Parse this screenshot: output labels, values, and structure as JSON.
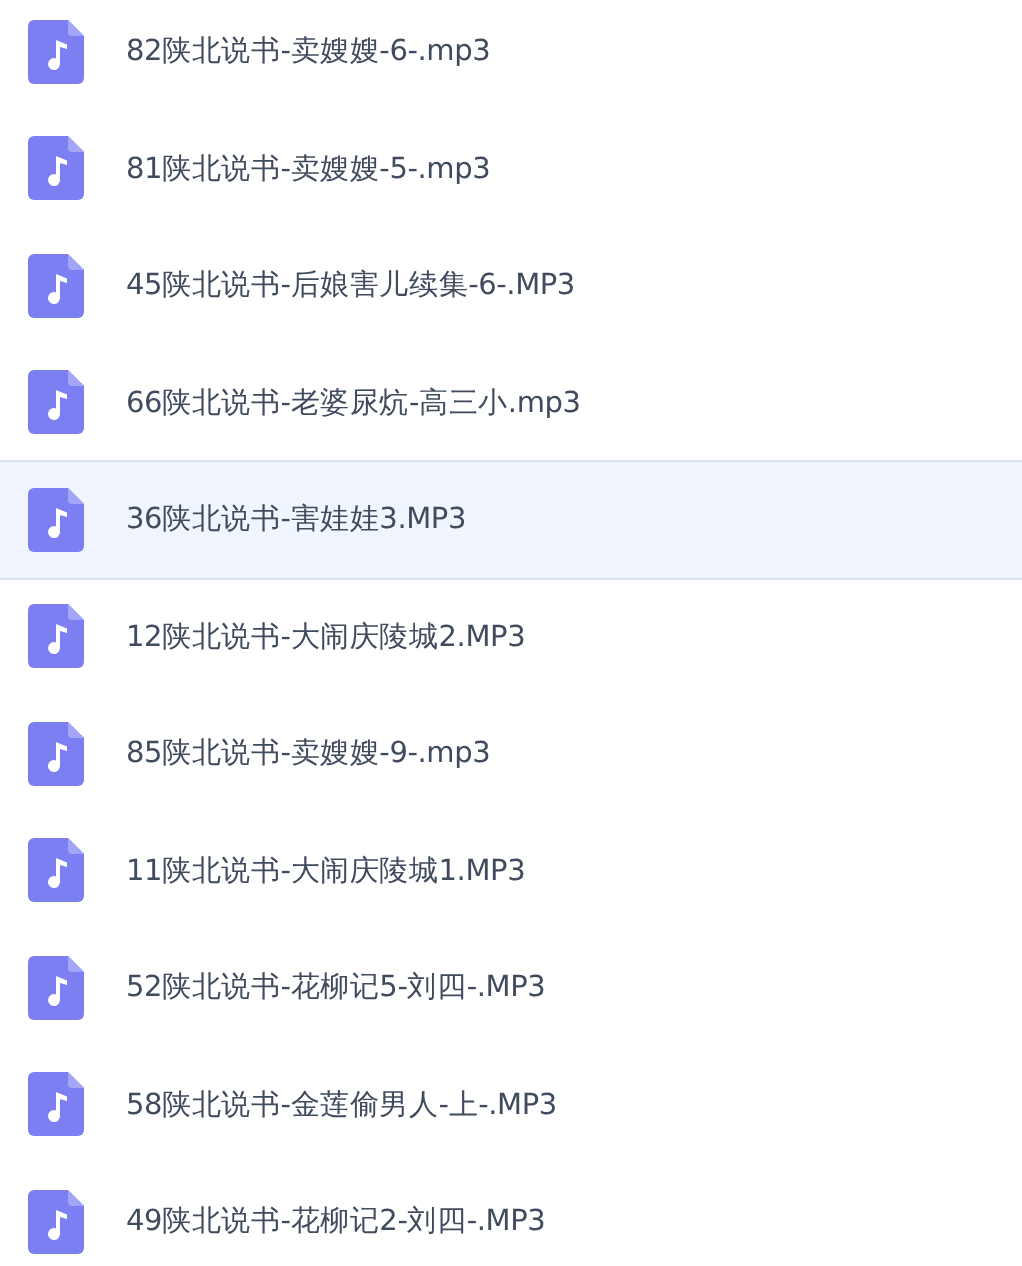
{
  "files": [
    {
      "name": "82陕北说书-卖嫂嫂-6-.mp3",
      "selected": false
    },
    {
      "name": "81陕北说书-卖嫂嫂-5-.mp3",
      "selected": false
    },
    {
      "name": "45陕北说书-后娘害儿续集-6-.MP3",
      "selected": false
    },
    {
      "name": "66陕北说书-老婆尿炕-高三小.mp3",
      "selected": false
    },
    {
      "name": "36陕北说书-害娃娃3.MP3",
      "selected": true
    },
    {
      "name": "12陕北说书-大闹庆陵城2.MP3",
      "selected": false
    },
    {
      "name": "85陕北说书-卖嫂嫂-9-.mp3",
      "selected": false
    },
    {
      "name": "11陕北说书-大闹庆陵城1.MP3",
      "selected": false
    },
    {
      "name": "52陕北说书-花柳记5-刘四-.MP3",
      "selected": false
    },
    {
      "name": "58陕北说书-金莲偷男人-上-.MP3",
      "selected": false
    },
    {
      "name": "49陕北说书-花柳记2-刘四-.MP3",
      "selected": false
    }
  ]
}
